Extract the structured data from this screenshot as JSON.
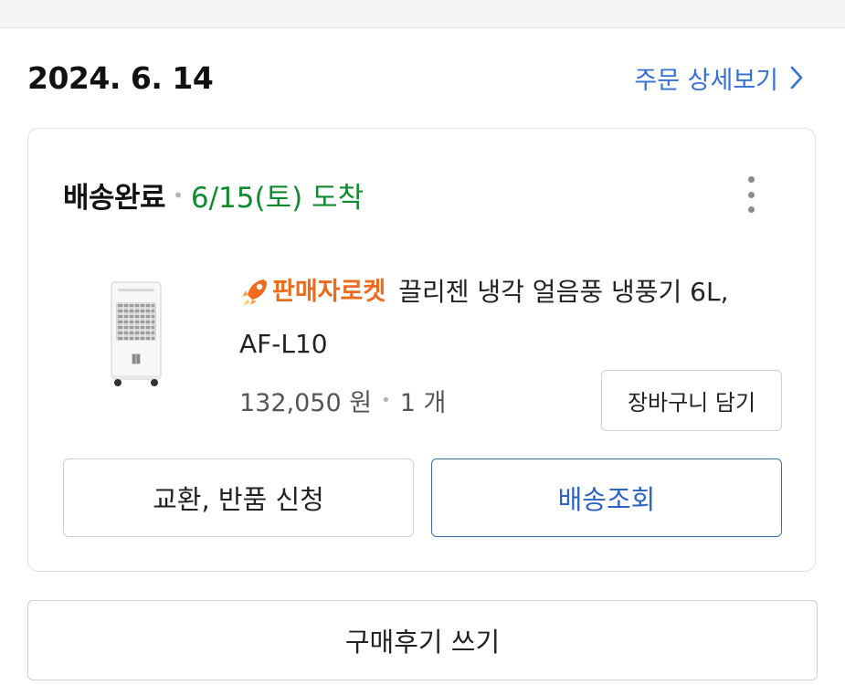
{
  "order": {
    "date": "2024. 6. 14",
    "detail_link": "주문 상세보기"
  },
  "delivery": {
    "status": "배송완료",
    "arrival": "6/15(토) 도착"
  },
  "product": {
    "badge": "판매자로켓",
    "name_line1": "끌리젠 냉각 얼음풍 냉풍기 6L,",
    "name_line2": "AF-L10",
    "price": "132,050 원",
    "quantity": "1 개"
  },
  "buttons": {
    "cart": "장바구니 담기",
    "exchange": "교환, 반품 신청",
    "tracking": "배송조회",
    "review": "구매후기 쓰기"
  },
  "colors": {
    "link": "#3470d8",
    "arrival_green": "#118a2f",
    "rocket_orange": "#ef6b1c",
    "tracking_blue": "#2e63c6"
  },
  "icons": {
    "detail": "chevron-right-icon",
    "more": "more-vertical-icon",
    "badge": "rocket-icon"
  }
}
